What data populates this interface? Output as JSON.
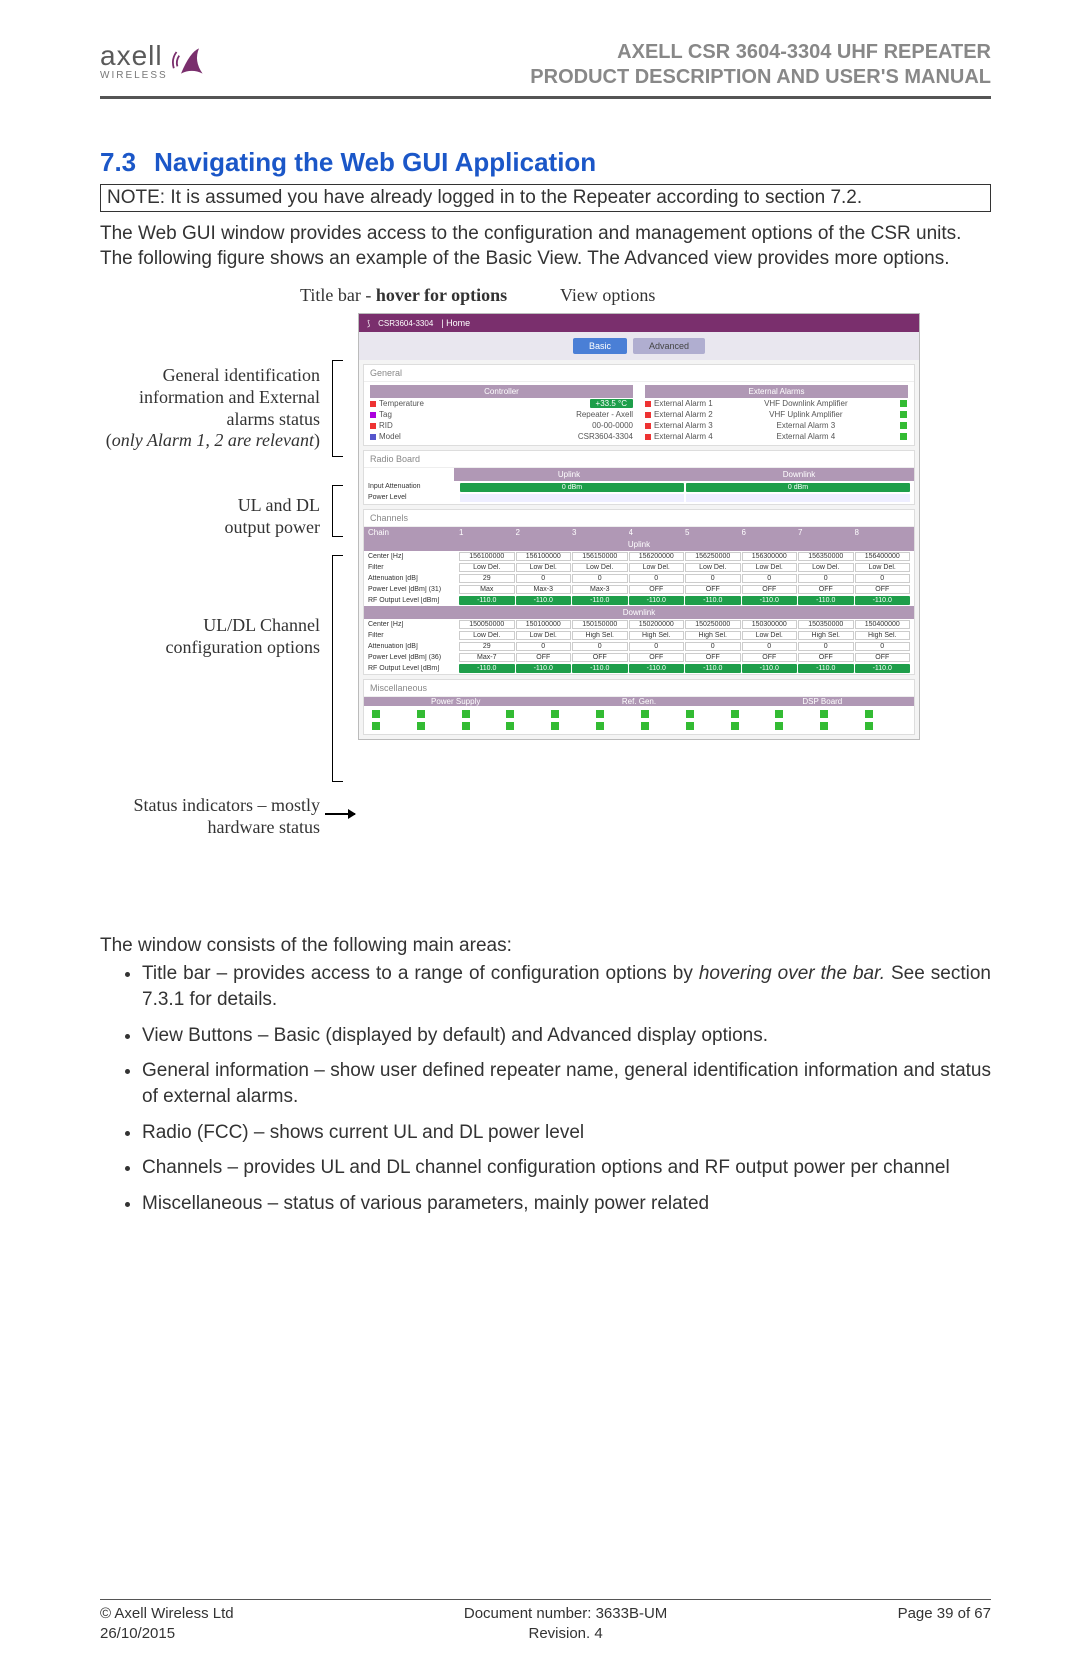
{
  "header": {
    "logo_text": "axell",
    "logo_sub": "WIRELESS",
    "line1": "AXELL CSR 3604-3304 UHF REPEATER",
    "line2": "PRODUCT DESCRIPTION AND USER'S MANUAL"
  },
  "section": {
    "number": "7.3",
    "title": "Navigating the Web GUI Application"
  },
  "note": "NOTE: It is assumed you have already logged in to the Repeater according to section 7.2.",
  "para1": "The Web GUI window provides access to the configuration and management options of the CSR units.",
  "para2": "The following figure shows an example of the Basic View. The Advanced view provides more options.",
  "figure_labels": {
    "titlebar_pre": "Title bar - ",
    "titlebar_bold": "hover for options",
    "view_options": "View options",
    "side1a": "General identification",
    "side1b": "information and External",
    "side1c": "alarms status",
    "side1d_pre": "(",
    "side1d_it": "only Alarm 1, 2 are relevant",
    "side1d_post": ")",
    "side2a": "UL and DL",
    "side2b": "output power",
    "side3a": "UL/DL Channel",
    "side3b": "configuration options",
    "side4a": "Status indicators – mostly",
    "side4b": "hardware status"
  },
  "mock": {
    "titlebar_model": "CSR3604-3304",
    "titlebar_home": "| Home",
    "tab_basic": "Basic",
    "tab_advanced": "Advanced",
    "general_title": "General",
    "controller": "Controller",
    "ext_alarms": "External Alarms",
    "temp_label": "Temperature",
    "temp_val": "+33.5 °C",
    "tag_label": "Tag",
    "tag_val": "Repeater - Axell",
    "rid_label": "RID",
    "rid_val": "00-00-0000",
    "model_label": "Model",
    "model_val": "CSR3604-3304",
    "ea1": "External Alarm 1",
    "ea1_v": "VHF Downlink Amplifier",
    "ea2": "External Alarm 2",
    "ea2_v": "VHF Uplink Amplifier",
    "ea3": "External Alarm 3",
    "ea3_v": "External Alarm 3",
    "ea4": "External Alarm 4",
    "ea4_v": "External Alarm 4",
    "radio_title": "Radio Board",
    "uplink": "Uplink",
    "downlink": "Downlink",
    "input_att": "Input Attenuation",
    "zero_dbm": "0 dBm",
    "power_level": "Power Level",
    "channels_title": "Channels",
    "chain": "Chain",
    "center_hz": "Center [Hz]",
    "filter": "Filter",
    "att_db": "Attenuation [dB]",
    "pl_dbm_31": "Power Level [dBm] (31)",
    "pl_dbm_36": "Power Level [dBm] (36)",
    "rf_out": "RF Output Level [dBm]",
    "ul_centers": [
      "156100000",
      "156100000",
      "156150000",
      "156200000",
      "156250000",
      "156300000",
      "156350000",
      "156400000"
    ],
    "ul_filter": [
      "Low Del.",
      "Low Del.",
      "Low Del.",
      "Low Del.",
      "Low Del.",
      "Low Del.",
      "Low Del.",
      "Low Del."
    ],
    "ul_att": [
      "29",
      "0",
      "0",
      "0",
      "0",
      "0",
      "0",
      "0"
    ],
    "ul_pl": [
      "Max",
      "Max-3",
      "Max-3",
      "OFF",
      "OFF",
      "OFF",
      "OFF",
      "OFF"
    ],
    "ul_rf": [
      "-110.0",
      "-110.0",
      "-110.0",
      "-110.0",
      "-110.0",
      "-110.0",
      "-110.0",
      "-110.0"
    ],
    "dl_centers": [
      "150050000",
      "150100000",
      "150150000",
      "150200000",
      "150250000",
      "150300000",
      "150350000",
      "150400000"
    ],
    "dl_filter": [
      "Low Del.",
      "Low Del.",
      "High Sel.",
      "High Sel.",
      "High Sel.",
      "Low Del.",
      "High Sel.",
      "High Sel."
    ],
    "dl_att": [
      "29",
      "0",
      "0",
      "0",
      "0",
      "0",
      "0",
      "0"
    ],
    "dl_pl": [
      "Max-7",
      "OFF",
      "OFF",
      "OFF",
      "OFF",
      "OFF",
      "OFF",
      "OFF"
    ],
    "dl_rf": [
      "-110.0",
      "-110.0",
      "-110.0",
      "-110.0",
      "-110.0",
      "-110.0",
      "-110.0",
      "-110.0"
    ],
    "misc_title": "Miscellaneous",
    "misc_h1": "Power Supply",
    "misc_h2": "Ref. Gen.",
    "misc_h3": "DSP Board"
  },
  "list_intro": "The window consists of the following main areas:",
  "bullets": {
    "b1_pre": "Title bar – provides access to a range of configuration options by ",
    "b1_it": "hovering over the bar.",
    "b1_post": " See section 7.3.1 for details.",
    "b2": "View Buttons – Basic (displayed by default) and Advanced display options.",
    "b3": "General information – show user defined repeater name, general identification information and status of external alarms.",
    "b4": "Radio (FCC) –  shows current UL and DL power level",
    "b5": "Channels – provides UL and DL channel configuration options and RF output power per channel",
    "b6": "Miscellaneous – status of various parameters, mainly power related"
  },
  "footer": {
    "left1": "© Axell Wireless Ltd",
    "left2": "26/10/2015",
    "center1": "Document number: 3633B-UM",
    "center2": "Revision. 4",
    "right": "Page 39 of 67"
  }
}
